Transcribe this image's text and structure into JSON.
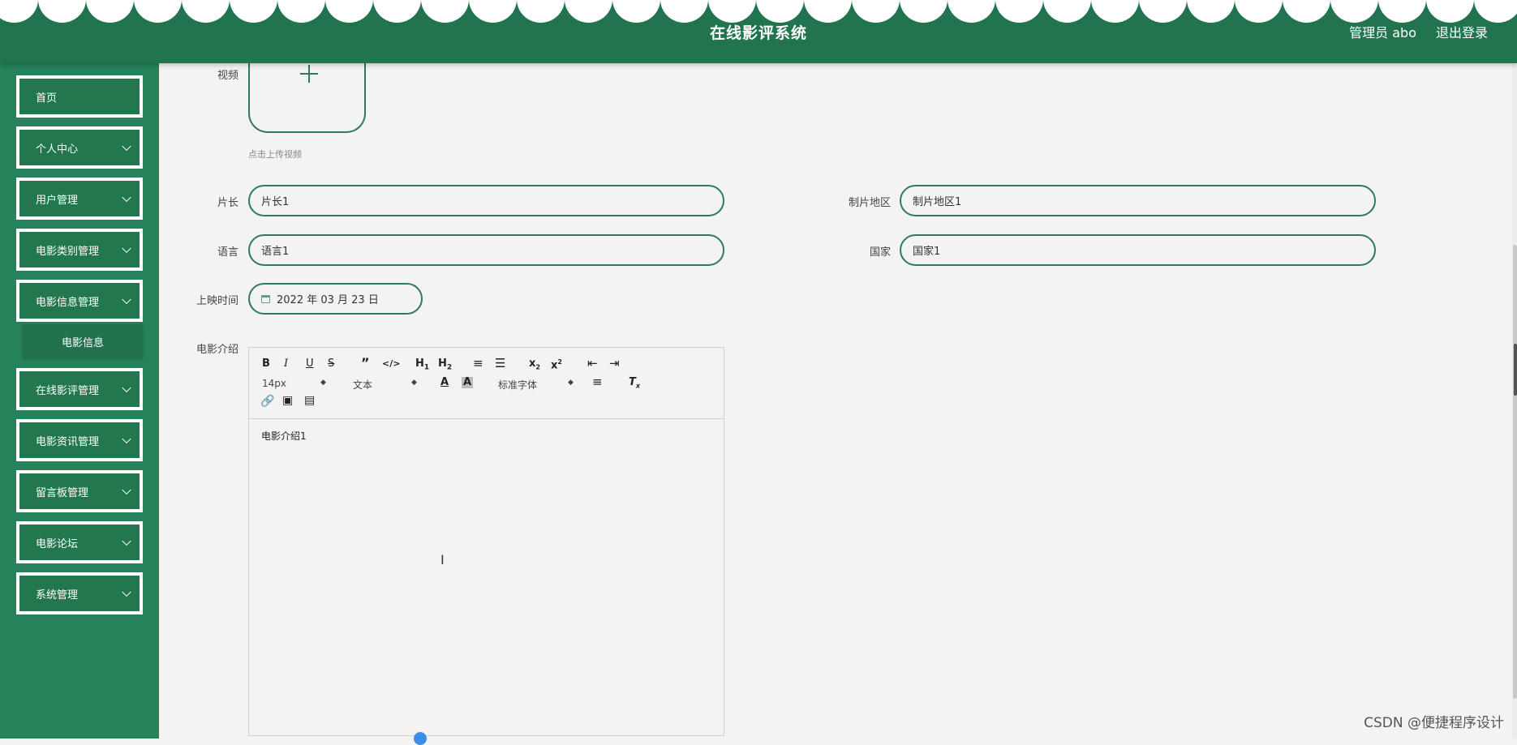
{
  "header": {
    "title": "在线影评系统",
    "admin_label": "管理员 abo",
    "logout_label": "退出登录"
  },
  "sidebar": {
    "items": [
      {
        "label": "首页"
      },
      {
        "label": "个人中心"
      },
      {
        "label": "用户管理"
      },
      {
        "label": "电影类别管理"
      },
      {
        "label": "电影信息管理"
      },
      {
        "label": "在线影评管理"
      },
      {
        "label": "电影资讯管理"
      },
      {
        "label": "留言板管理"
      },
      {
        "label": "电影论坛"
      },
      {
        "label": "系统管理"
      }
    ],
    "subitem": {
      "label": "电影信息"
    }
  },
  "form": {
    "video_label": "视频",
    "upload_tip": "点击上传视频",
    "director_label": "片长",
    "director_value": "片长1",
    "region_label": "制片地区",
    "region_value": "制片地区1",
    "language_label": "语言",
    "language_value": "语言1",
    "country_label": "国家",
    "country_value": "国家1",
    "release_label": "上映时间",
    "release_value": "2022 年 03 月 23 日",
    "intro_label": "电影介绍"
  },
  "editor": {
    "font_size": "14px",
    "text_type": "文本",
    "font_family": "标准字体",
    "content": "电影介绍1"
  },
  "watermark": "CSDN @便捷程序设计"
}
